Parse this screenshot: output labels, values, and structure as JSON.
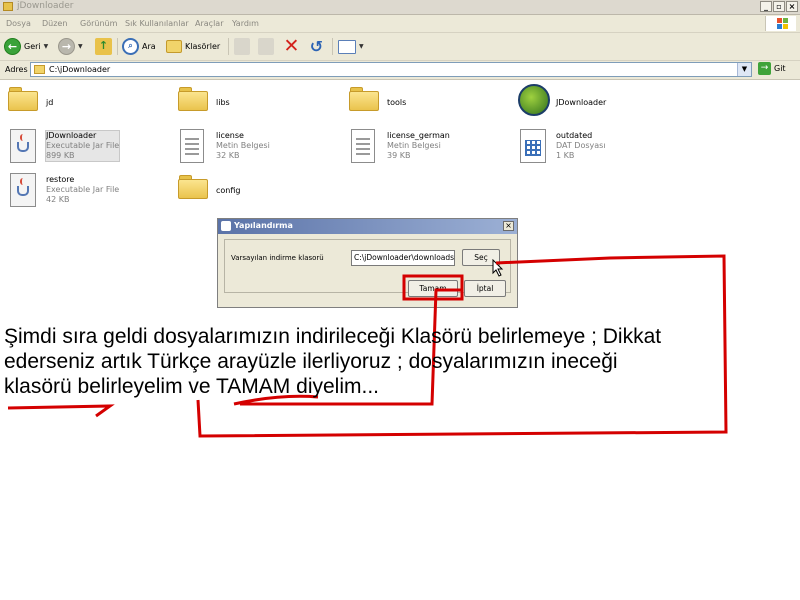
{
  "window": {
    "title": "jDownloader"
  },
  "menu": [
    "Dosya",
    "Düzen",
    "Görünüm",
    "Sık Kullanılanlar",
    "Araçlar",
    "Yardım"
  ],
  "toolbar": {
    "back": "Geri",
    "search": "Ara",
    "folders": "Klasörler"
  },
  "address": {
    "label": "Adres",
    "value": "C:\\jDownloader",
    "go": "Git"
  },
  "files": [
    {
      "name": "jd",
      "type": "",
      "size": ""
    },
    {
      "name": "libs",
      "type": "",
      "size": ""
    },
    {
      "name": "tools",
      "type": "",
      "size": ""
    },
    {
      "name": "JDownloader",
      "type": "",
      "size": ""
    },
    {
      "name": "JDownloader",
      "type": "Executable Jar File",
      "size": "899 KB"
    },
    {
      "name": "license",
      "type": "Metin Belgesi",
      "size": "32 KB"
    },
    {
      "name": "license_german",
      "type": "Metin Belgesi",
      "size": "39 KB"
    },
    {
      "name": "outdated",
      "type": "DAT Dosyası",
      "size": "1 KB"
    },
    {
      "name": "restore",
      "type": "Executable Jar File",
      "size": "42 KB"
    },
    {
      "name": "config",
      "type": "",
      "size": ""
    }
  ],
  "dialog": {
    "title": "Yapılandırma",
    "field_label": "Varsayılan indirme klasorü",
    "field_value": "C:\\jDownloader\\downloads",
    "browse": "Seç",
    "ok": "Tamam",
    "cancel": "İptal"
  },
  "caption": {
    "line1": "Şimdi sıra geldi dosyalarımızın indirileceği Klasörü belirlemeye ; Dikkat",
    "line2": "ederseniz artık Türkçe arayüzle ilerliyoruz ; dosyalarımızın ineceği",
    "line3": "klasörü belirleyelim ve TAMAM diyelim..."
  },
  "colors": {
    "annotation": "#d40000",
    "title_bar": "#5b73a8"
  }
}
